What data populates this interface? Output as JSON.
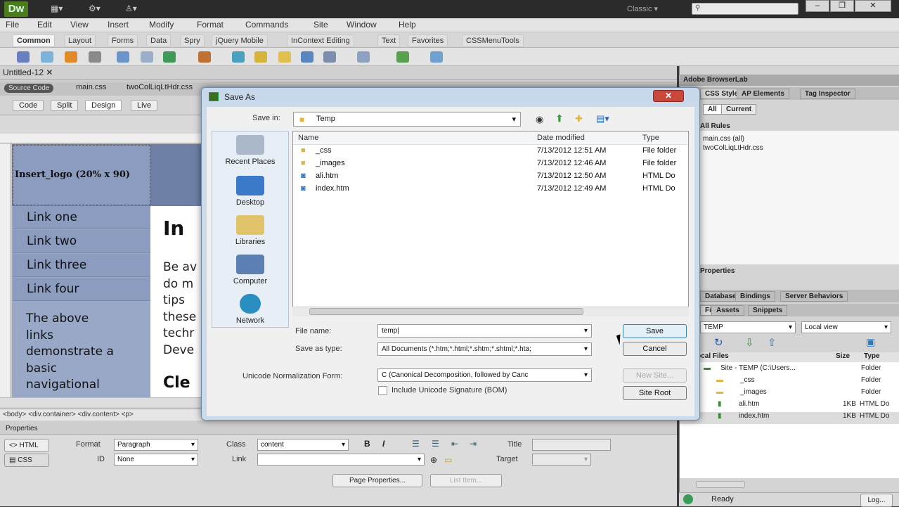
{
  "app": {
    "logo": "Dw",
    "workspace": "Classic",
    "menu": [
      "File",
      "Edit",
      "View",
      "Insert",
      "Modify",
      "Format",
      "Commands",
      "Site",
      "Window",
      "Help"
    ],
    "insert_tabs": [
      "Common",
      "Layout",
      "Forms",
      "Data",
      "Spry",
      "jQuery Mobile",
      "InContext Editing",
      "Text",
      "Favorites",
      "CSSMenuTools"
    ]
  },
  "document": {
    "tab": "Untitled-12",
    "source_code": "Source Code",
    "related_files": [
      "main.css",
      "twoColLiqLtHdr.css"
    ],
    "views": [
      "Code",
      "Split",
      "Design",
      "Live"
    ],
    "logo_placeholder": "Insert_logo (20% x 90)",
    "nav_links": [
      "Link one",
      "Link two",
      "Link three",
      "Link four"
    ],
    "sidebar_text": [
      "The above",
      "links",
      "demonstrate a",
      "basic",
      "navigational"
    ],
    "content_title": "In",
    "content_body": [
      "Be av",
      "do m",
      "tips",
      "these",
      "techr",
      "Deve"
    ],
    "content_subtitle": "Cle",
    "tag_selector": "<body> <div.container> <div.content> <p>"
  },
  "properties": {
    "title": "Properties",
    "html_btn": "HTML",
    "css_btn": "CSS",
    "format_label": "Format",
    "format_value": "Paragraph",
    "id_label": "ID",
    "id_value": "None",
    "class_label": "Class",
    "class_value": "content",
    "link_label": "Link",
    "title_label": "Title",
    "target_label": "Target",
    "page_properties": "Page Properties...",
    "list_item": "List Item..."
  },
  "right_panel": {
    "browserlab": "Adobe BrowserLab",
    "tabs_top": [
      "CSS Styles",
      "AP Elements",
      "Tag Inspector"
    ],
    "all_label": "All",
    "current_label": "Current",
    "rules_label": "All Rules",
    "rules": [
      "main.css (all)",
      "twoColLiqLtHdr.css"
    ],
    "properties_label": "Properties",
    "tabs_mid": [
      "Databases",
      "Bindings",
      "Server Behaviors"
    ],
    "tabs_files": [
      "Files",
      "Assets",
      "Snippets"
    ],
    "site_select": "TEMP",
    "view_select": "Local view",
    "files_header": [
      "Local Files",
      "Size",
      "Type"
    ],
    "files": [
      {
        "name": "Site - TEMP (C:\\Users...",
        "size": "",
        "type": "Folder"
      },
      {
        "name": "_css",
        "size": "",
        "type": "Folder"
      },
      {
        "name": "_images",
        "size": "",
        "type": "Folder"
      },
      {
        "name": "ali.htm",
        "size": "1KB",
        "type": "HTML Do"
      },
      {
        "name": "index.htm",
        "size": "1KB",
        "type": "HTML Do"
      }
    ],
    "status": "Ready",
    "log_btn": "Log..."
  },
  "dialog": {
    "title": "Save As",
    "close": "✕",
    "save_in_label": "Save in:",
    "save_in_value": "Temp",
    "places": [
      "Recent Places",
      "Desktop",
      "Libraries",
      "Computer",
      "Network"
    ],
    "columns": [
      "Name",
      "Date modified",
      "Type"
    ],
    "files": [
      {
        "name": "_css",
        "date": "7/13/2012 12:51 AM",
        "type": "File folder"
      },
      {
        "name": "_images",
        "date": "7/13/2012 12:46 AM",
        "type": "File folder"
      },
      {
        "name": "ali.htm",
        "date": "7/13/2012 12:50 AM",
        "type": "HTML Do"
      },
      {
        "name": "index.htm",
        "date": "7/13/2012 12:49 AM",
        "type": "HTML Do"
      }
    ],
    "file_name_label": "File name:",
    "file_name_value": "temp",
    "save_type_label": "Save as type:",
    "save_type_value": "All Documents (*.htm;*.html;*.shtm;*.shtml;*.hta;",
    "unicode_label": "Unicode Normalization Form:",
    "unicode_value": "C (Canonical Decomposition, followed by Canc",
    "bom_label": "Include Unicode Signature (BOM)",
    "save_btn": "Save",
    "cancel_btn": "Cancel",
    "new_site_btn": "New Site...",
    "site_root_btn": "Site Root"
  }
}
